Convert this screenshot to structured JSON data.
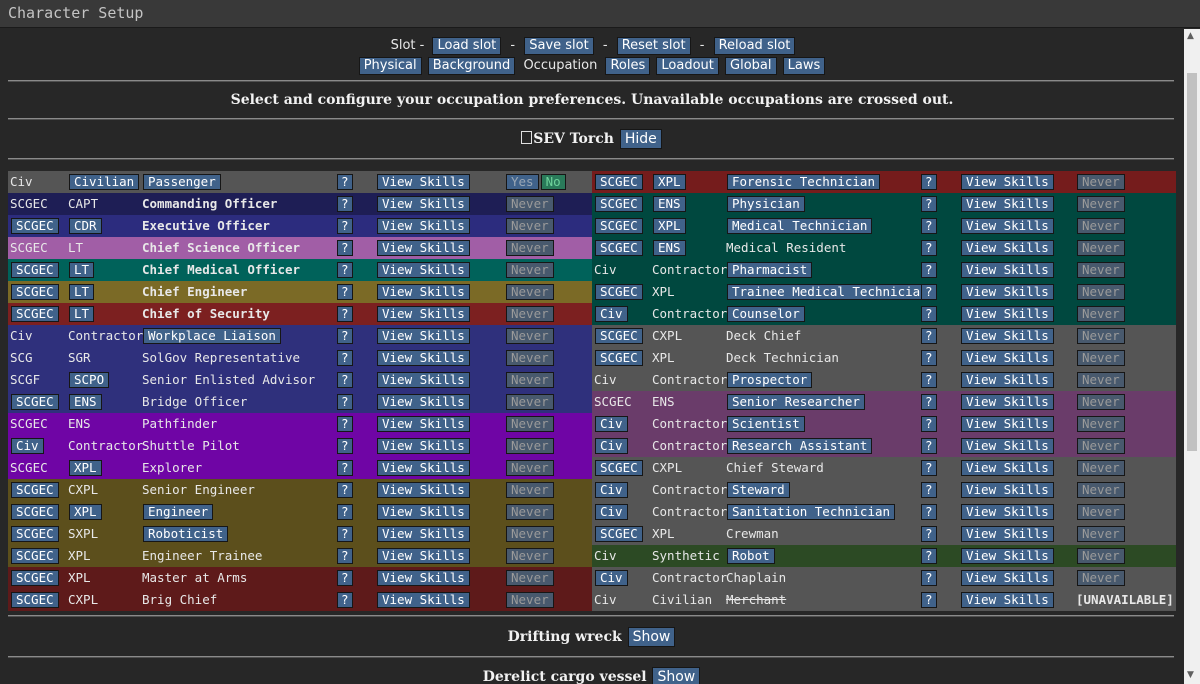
{
  "window": {
    "title": "Character Setup"
  },
  "nav": {
    "slot_label": "Slot -",
    "sep": "-",
    "load_slot": "Load slot",
    "save_slot": "Save slot",
    "reset_slot": "Reset slot",
    "reload_slot": "Reload slot",
    "tabs": [
      "Physical",
      "Background",
      "Occupation",
      "Roles",
      "Loadout",
      "Global",
      "Laws"
    ],
    "active_tab": "Occupation"
  },
  "instruction": "Select and configure your occupation preferences. Unavailable occupations are crossed out.",
  "sections": [
    {
      "name": "SEV Torch",
      "toggle": "Hide"
    },
    {
      "name": "Drifting wreck",
      "toggle": "Show"
    },
    {
      "name": "Derelict cargo vessel",
      "toggle": "Show"
    }
  ],
  "common": {
    "help": "?",
    "view_skills": "View Skills",
    "never": "Never",
    "yes": "Yes",
    "no": "No",
    "unavailable": "[UNAVAILABLE]"
  },
  "colors": {
    "civ": "#555555",
    "command": "#2c2c7e",
    "science": "#a15ea6",
    "medical": "#00625a",
    "engineering": "#7b6a26",
    "security": "#7c2020",
    "bridge": "#2f307c",
    "exploration": "#6f05a5",
    "forensic": "#751c1c",
    "supply": "#505050",
    "research": "#6a3c6a",
    "service": "#505050",
    "synthetic": "#2c4a24",
    "button": "#40628a"
  },
  "left_jobs": [
    {
      "branch": "Civ",
      "rank": "Civilian",
      "title": "Passenger",
      "pref": "yesno",
      "color": "#555555",
      "branch_btn": false,
      "rank_btn": true,
      "title_btn": true,
      "bold": false
    },
    {
      "branch": "SCGEC",
      "rank": "CAPT",
      "title": "Commanding Officer",
      "pref": "never",
      "color": "#1e1e55",
      "branch_btn": false,
      "rank_btn": false,
      "title_btn": false,
      "bold": true
    },
    {
      "branch": "SCGEC",
      "rank": "CDR",
      "title": "Executive Officer",
      "pref": "never",
      "color": "#2c2c7e",
      "branch_btn": true,
      "rank_btn": true,
      "title_btn": false,
      "bold": true
    },
    {
      "branch": "SCGEC",
      "rank": "LT",
      "title": "Chief Science Officer",
      "pref": "never",
      "color": "#a15ea6",
      "branch_btn": false,
      "rank_btn": false,
      "title_btn": false,
      "bold": true
    },
    {
      "branch": "SCGEC",
      "rank": "LT",
      "title": "Chief Medical Officer",
      "pref": "never",
      "color": "#00625a",
      "branch_btn": true,
      "rank_btn": true,
      "title_btn": false,
      "bold": true
    },
    {
      "branch": "SCGEC",
      "rank": "LT",
      "title": "Chief Engineer",
      "pref": "never",
      "color": "#7b6a26",
      "branch_btn": true,
      "rank_btn": true,
      "title_btn": false,
      "bold": true
    },
    {
      "branch": "SCGEC",
      "rank": "LT",
      "title": "Chief of Security",
      "pref": "never",
      "color": "#7c2020",
      "branch_btn": true,
      "rank_btn": true,
      "title_btn": false,
      "bold": true
    },
    {
      "branch": "Civ",
      "rank": "Contractor",
      "title": "Workplace Liaison",
      "pref": "never",
      "color": "#2f307c",
      "branch_btn": false,
      "rank_btn": false,
      "title_btn": true,
      "bold": false
    },
    {
      "branch": "SCG",
      "rank": "SGR",
      "title": "SolGov Representative",
      "pref": "never",
      "color": "#2f307c",
      "branch_btn": false,
      "rank_btn": false,
      "title_btn": false,
      "bold": false
    },
    {
      "branch": "SCGF",
      "rank": "SCPO",
      "title": "Senior Enlisted Advisor",
      "pref": "never",
      "color": "#2f307c",
      "branch_btn": false,
      "rank_btn": true,
      "title_btn": false,
      "bold": false
    },
    {
      "branch": "SCGEC",
      "rank": "ENS",
      "title": "Bridge Officer",
      "pref": "never",
      "color": "#2f307c",
      "branch_btn": true,
      "rank_btn": true,
      "title_btn": false,
      "bold": false
    },
    {
      "branch": "SCGEC",
      "rank": "ENS",
      "title": "Pathfinder",
      "pref": "never",
      "color": "#6f05a5",
      "branch_btn": false,
      "rank_btn": false,
      "title_btn": false,
      "bold": false
    },
    {
      "branch": "Civ",
      "rank": "Contractor",
      "title": "Shuttle Pilot",
      "pref": "never",
      "color": "#6f05a5",
      "branch_btn": true,
      "rank_btn": false,
      "title_btn": false,
      "bold": false
    },
    {
      "branch": "SCGEC",
      "rank": "XPL",
      "title": "Explorer",
      "pref": "never",
      "color": "#6f05a5",
      "branch_btn": false,
      "rank_btn": true,
      "title_btn": false,
      "bold": false
    },
    {
      "branch": "SCGEC",
      "rank": "CXPL",
      "title": "Senior Engineer",
      "pref": "never",
      "color": "#5c4f1c",
      "branch_btn": true,
      "rank_btn": false,
      "title_btn": false,
      "bold": false
    },
    {
      "branch": "SCGEC",
      "rank": "XPL",
      "title": "Engineer",
      "pref": "never",
      "color": "#5c4f1c",
      "branch_btn": true,
      "rank_btn": true,
      "title_btn": true,
      "bold": false
    },
    {
      "branch": "SCGEC",
      "rank": "SXPL",
      "title": "Roboticist",
      "pref": "never",
      "color": "#5c4f1c",
      "branch_btn": true,
      "rank_btn": false,
      "title_btn": true,
      "bold": false
    },
    {
      "branch": "SCGEC",
      "rank": "XPL",
      "title": "Engineer Trainee",
      "pref": "never",
      "color": "#5c4f1c",
      "branch_btn": true,
      "rank_btn": false,
      "title_btn": false,
      "bold": false
    },
    {
      "branch": "SCGEC",
      "rank": "XPL",
      "title": "Master at Arms",
      "pref": "never",
      "color": "#5e1a1a",
      "branch_btn": true,
      "rank_btn": false,
      "title_btn": false,
      "bold": false
    },
    {
      "branch": "SCGEC",
      "rank": "CXPL",
      "title": "Brig Chief",
      "pref": "never",
      "color": "#5e1a1a",
      "branch_btn": true,
      "rank_btn": false,
      "title_btn": false,
      "bold": false
    }
  ],
  "right_jobs": [
    {
      "branch": "SCGEC",
      "rank": "XPL",
      "title": "Forensic Technician",
      "pref": "never",
      "color": "#751c1c",
      "branch_btn": true,
      "rank_btn": true,
      "title_btn": true,
      "strike": false
    },
    {
      "branch": "SCGEC",
      "rank": "ENS",
      "title": "Physician",
      "pref": "never",
      "color": "#00483f",
      "branch_btn": true,
      "rank_btn": true,
      "title_btn": true,
      "strike": false
    },
    {
      "branch": "SCGEC",
      "rank": "XPL",
      "title": "Medical Technician",
      "pref": "never",
      "color": "#00483f",
      "branch_btn": true,
      "rank_btn": true,
      "title_btn": true,
      "strike": false
    },
    {
      "branch": "SCGEC",
      "rank": "ENS",
      "title": "Medical Resident",
      "pref": "never",
      "color": "#00483f",
      "branch_btn": true,
      "rank_btn": true,
      "title_btn": false,
      "strike": false
    },
    {
      "branch": "Civ",
      "rank": "Contractor",
      "title": "Pharmacist",
      "pref": "never",
      "color": "#00483f",
      "branch_btn": false,
      "rank_btn": false,
      "title_btn": true,
      "strike": false
    },
    {
      "branch": "SCGEC",
      "rank": "XPL",
      "title": "Trainee Medical Technician",
      "pref": "never",
      "color": "#00483f",
      "branch_btn": true,
      "rank_btn": false,
      "title_btn": true,
      "strike": false
    },
    {
      "branch": "Civ",
      "rank": "Contractor",
      "title": "Counselor",
      "pref": "never",
      "color": "#00483f",
      "branch_btn": true,
      "rank_btn": false,
      "title_btn": true,
      "strike": false
    },
    {
      "branch": "SCGEC",
      "rank": "CXPL",
      "title": "Deck Chief",
      "pref": "never",
      "color": "#555555",
      "branch_btn": true,
      "rank_btn": false,
      "title_btn": false,
      "strike": false
    },
    {
      "branch": "SCGEC",
      "rank": "XPL",
      "title": "Deck Technician",
      "pref": "never",
      "color": "#555555",
      "branch_btn": true,
      "rank_btn": false,
      "title_btn": false,
      "strike": false
    },
    {
      "branch": "Civ",
      "rank": "Contractor",
      "title": "Prospector",
      "pref": "never",
      "color": "#555555",
      "branch_btn": false,
      "rank_btn": false,
      "title_btn": true,
      "strike": false
    },
    {
      "branch": "SCGEC",
      "rank": "ENS",
      "title": "Senior Researcher",
      "pref": "never",
      "color": "#6a3c6a",
      "branch_btn": false,
      "rank_btn": false,
      "title_btn": true,
      "strike": false
    },
    {
      "branch": "Civ",
      "rank": "Contractor",
      "title": "Scientist",
      "pref": "never",
      "color": "#6a3c6a",
      "branch_btn": true,
      "rank_btn": false,
      "title_btn": true,
      "strike": false
    },
    {
      "branch": "Civ",
      "rank": "Contractor",
      "title": "Research Assistant",
      "pref": "never",
      "color": "#6a3c6a",
      "branch_btn": true,
      "rank_btn": false,
      "title_btn": true,
      "strike": false
    },
    {
      "branch": "SCGEC",
      "rank": "CXPL",
      "title": "Chief Steward",
      "pref": "never",
      "color": "#555555",
      "branch_btn": true,
      "rank_btn": false,
      "title_btn": false,
      "strike": false
    },
    {
      "branch": "Civ",
      "rank": "Contractor",
      "title": "Steward",
      "pref": "never",
      "color": "#555555",
      "branch_btn": true,
      "rank_btn": false,
      "title_btn": true,
      "strike": false
    },
    {
      "branch": "Civ",
      "rank": "Contractor",
      "title": "Sanitation Technician",
      "pref": "never",
      "color": "#555555",
      "branch_btn": true,
      "rank_btn": false,
      "title_btn": true,
      "strike": false
    },
    {
      "branch": "SCGEC",
      "rank": "XPL",
      "title": "Crewman",
      "pref": "never",
      "color": "#555555",
      "branch_btn": true,
      "rank_btn": false,
      "title_btn": false,
      "strike": false
    },
    {
      "branch": "Civ",
      "rank": "Synthetic",
      "title": "Robot",
      "pref": "never",
      "color": "#2c4a24",
      "branch_btn": false,
      "rank_btn": false,
      "title_btn": true,
      "strike": false
    },
    {
      "branch": "Civ",
      "rank": "Contractor",
      "title": "Chaplain",
      "pref": "never",
      "color": "#555555",
      "branch_btn": true,
      "rank_btn": false,
      "title_btn": false,
      "strike": false
    },
    {
      "branch": "Civ",
      "rank": "Civilian",
      "title": "Merchant",
      "pref": "unavailable",
      "color": "#555555",
      "branch_btn": false,
      "rank_btn": false,
      "title_btn": false,
      "strike": true
    }
  ]
}
